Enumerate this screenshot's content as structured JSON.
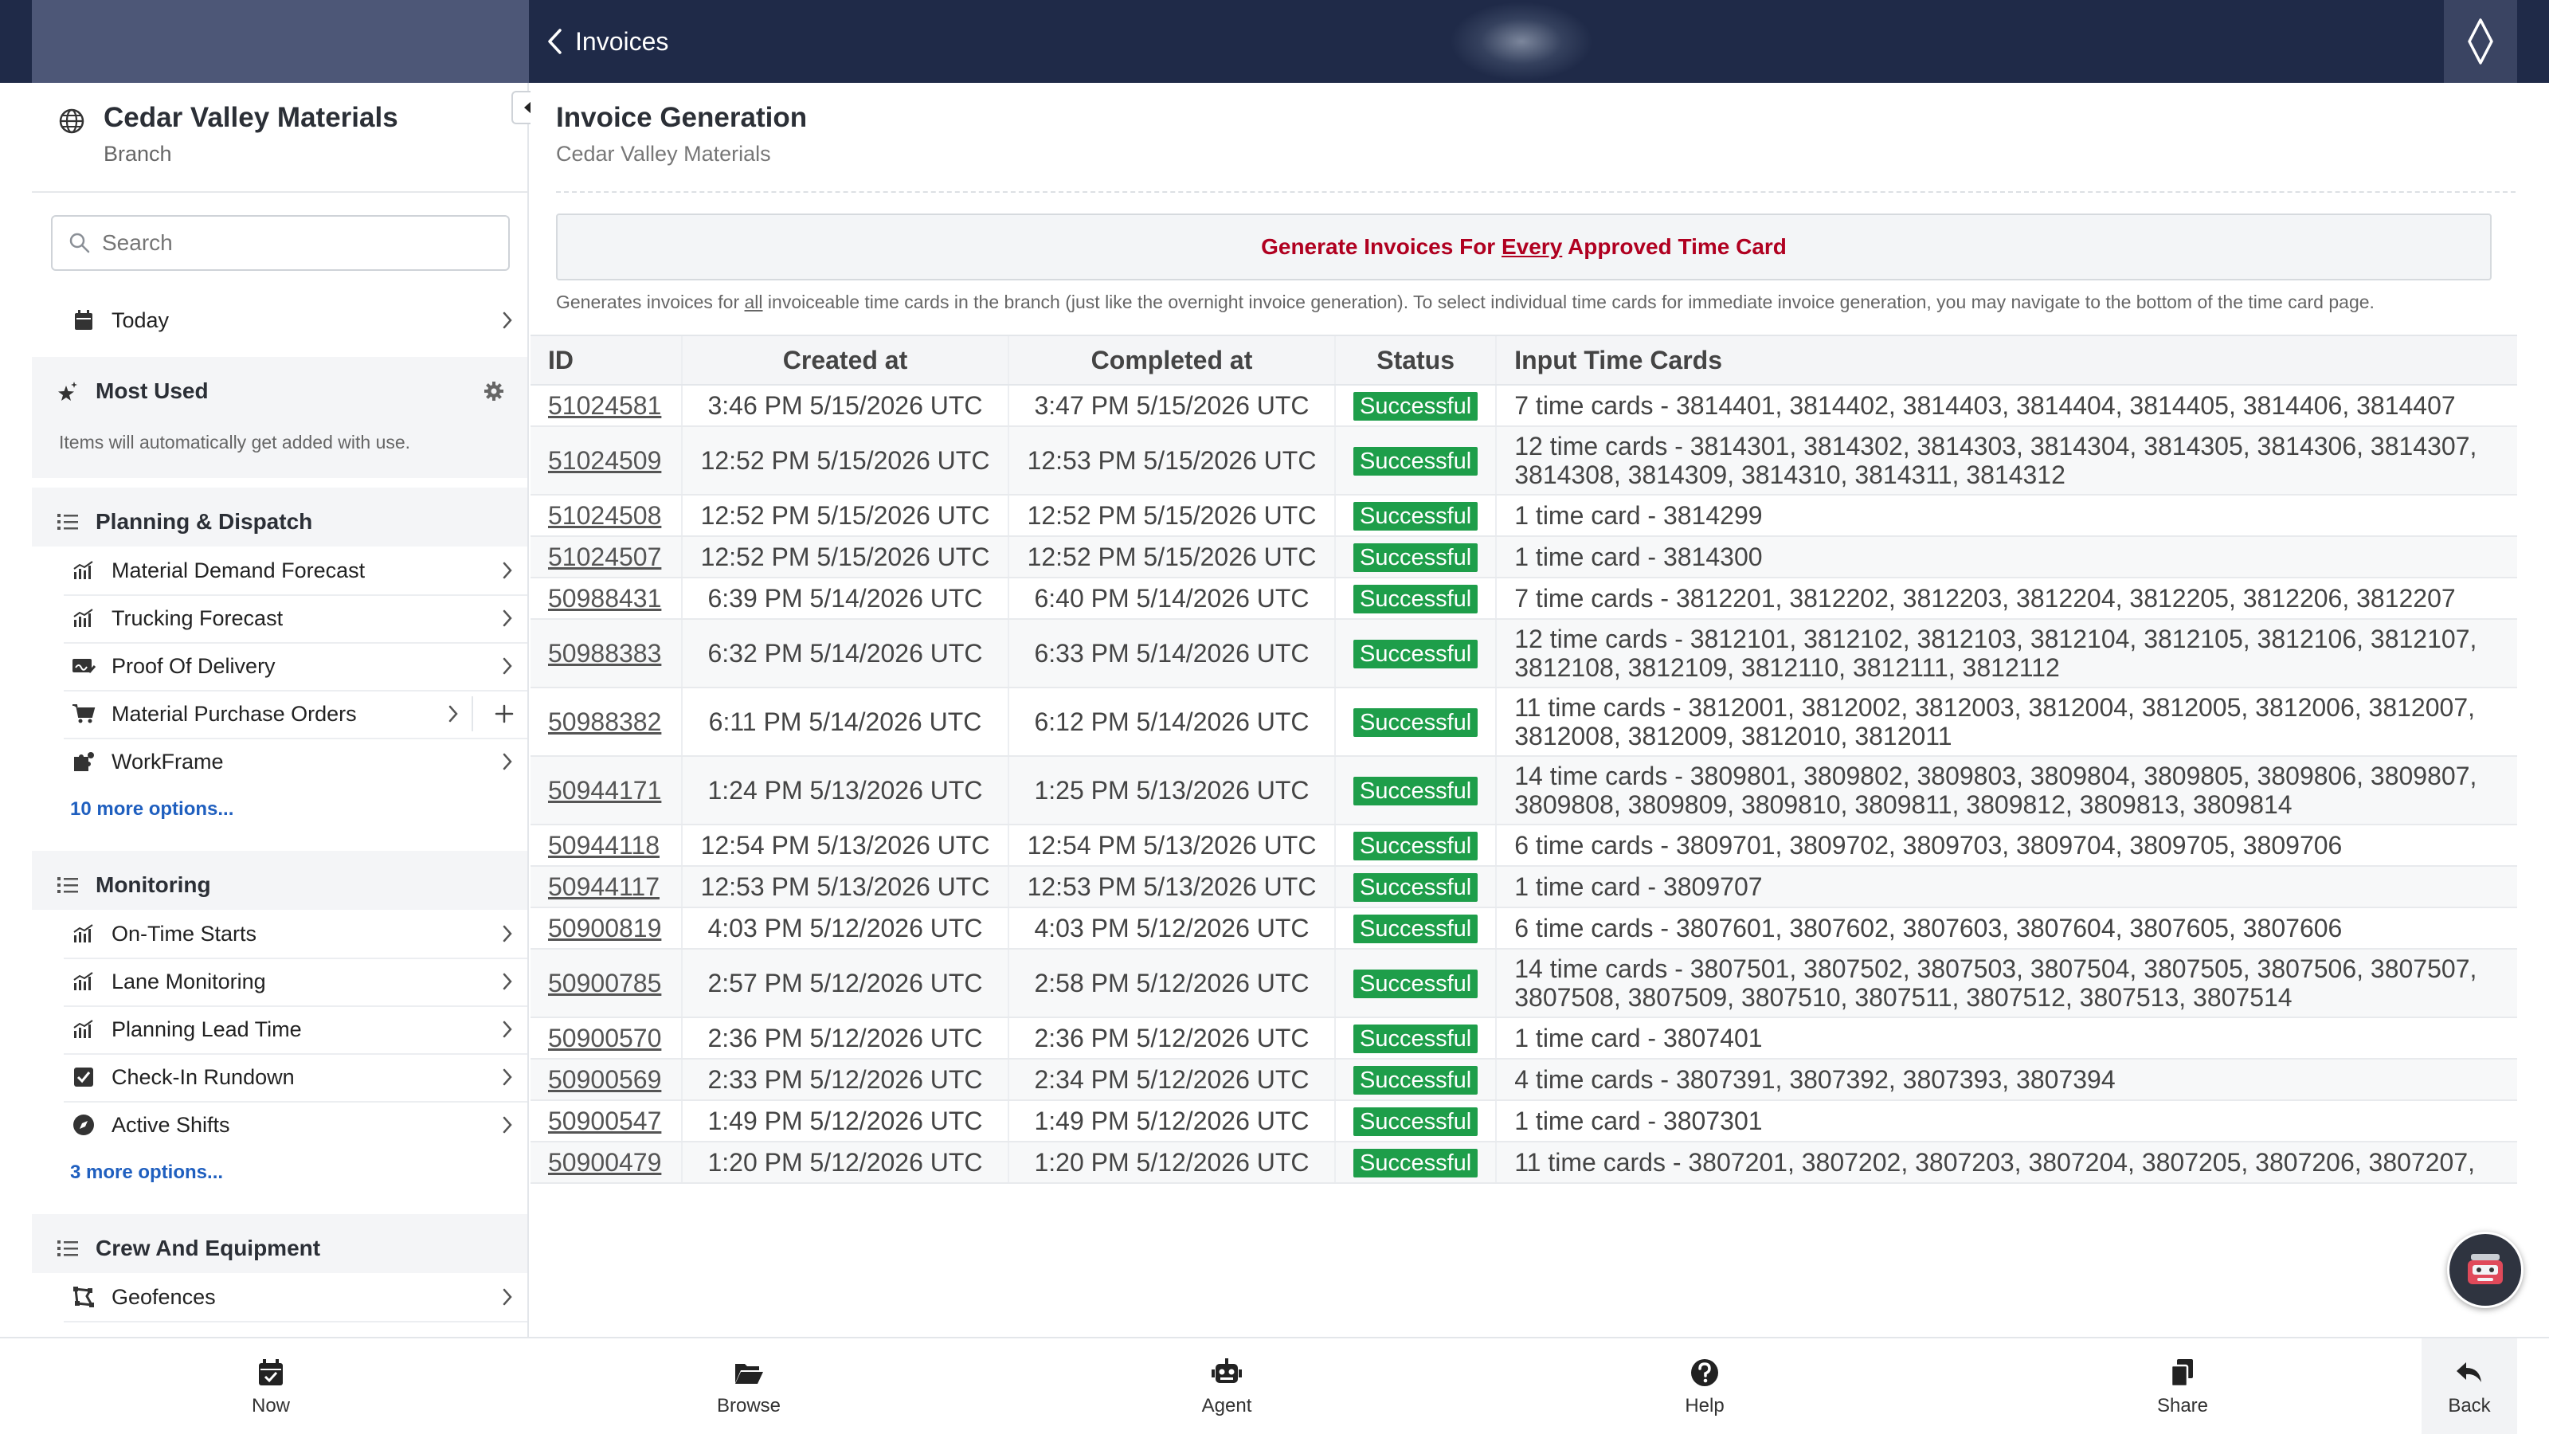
{
  "topbar": {
    "back_label": "Invoices"
  },
  "branch": {
    "name": "Cedar Valley Materials",
    "type": "Branch"
  },
  "search": {
    "placeholder": "Search"
  },
  "today": {
    "label": "Today"
  },
  "most_used": {
    "title": "Most Used",
    "note": "Items will automatically get added with use."
  },
  "planning": {
    "title": "Planning & Dispatch",
    "items": [
      {
        "label": "Material Demand Forecast",
        "icon": "chart-icon"
      },
      {
        "label": "Trucking Forecast",
        "icon": "chart-icon"
      },
      {
        "label": "Proof Of Delivery",
        "icon": "signature-icon"
      },
      {
        "label": "Material Purchase Orders",
        "icon": "cart-icon"
      },
      {
        "label": "WorkFrame",
        "icon": "puzzle-icon"
      }
    ],
    "more": "10 more options..."
  },
  "monitoring": {
    "title": "Monitoring",
    "items": [
      {
        "label": "On-Time Starts",
        "icon": "chart-icon"
      },
      {
        "label": "Lane Monitoring",
        "icon": "chart-icon"
      },
      {
        "label": "Planning Lead Time",
        "icon": "chart-icon"
      },
      {
        "label": "Check-In Rundown",
        "icon": "checkbox-icon"
      },
      {
        "label": "Active Shifts",
        "icon": "compass-icon"
      }
    ],
    "more": "3 more options..."
  },
  "crew": {
    "title": "Crew And Equipment",
    "items": [
      {
        "label": "Geofences",
        "icon": "geofence-icon"
      }
    ]
  },
  "main": {
    "title": "Invoice Generation",
    "subtitle": "Cedar Valley Materials",
    "generate_pre": "Generate Invoices For ",
    "generate_em": "Every",
    "generate_post": " Approved Time Card",
    "desc_pre": "Generates invoices for ",
    "desc_em": "all",
    "desc_post": " invoiceable time cards in the branch (just like the overnight invoice generation). To select individual time cards for immediate invoice generation, you may navigate to the bottom of the time card page."
  },
  "table": {
    "headers": [
      "ID",
      "Created at",
      "Completed at",
      "Status",
      "Input Time Cards"
    ],
    "rows": [
      {
        "id": "51024581",
        "created": "3:46 PM 5/15/2026 UTC",
        "completed": "3:47 PM 5/15/2026 UTC",
        "status": "Successful",
        "cards": "7 time cards - 3814401, 3814402, 3814403, 3814404, 3814405, 3814406, 3814407"
      },
      {
        "id": "51024509",
        "created": "12:52 PM 5/15/2026 UTC",
        "completed": "12:53 PM 5/15/2026 UTC",
        "status": "Successful",
        "cards": "12 time cards - 3814301, 3814302, 3814303, 3814304, 3814305, 3814306, 3814307, 3814308, 3814309, 3814310, 3814311, 3814312"
      },
      {
        "id": "51024508",
        "created": "12:52 PM 5/15/2026 UTC",
        "completed": "12:52 PM 5/15/2026 UTC",
        "status": "Successful",
        "cards": "1 time card - 3814299"
      },
      {
        "id": "51024507",
        "created": "12:52 PM 5/15/2026 UTC",
        "completed": "12:52 PM 5/15/2026 UTC",
        "status": "Successful",
        "cards": "1 time card - 3814300"
      },
      {
        "id": "50988431",
        "created": "6:39 PM 5/14/2026 UTC",
        "completed": "6:40 PM 5/14/2026 UTC",
        "status": "Successful",
        "cards": "7 time cards - 3812201, 3812202, 3812203, 3812204, 3812205, 3812206, 3812207"
      },
      {
        "id": "50988383",
        "created": "6:32 PM 5/14/2026 UTC",
        "completed": "6:33 PM 5/14/2026 UTC",
        "status": "Successful",
        "cards": "12 time cards - 3812101, 3812102, 3812103, 3812104, 3812105, 3812106, 3812107, 3812108, 3812109, 3812110, 3812111, 3812112"
      },
      {
        "id": "50988382",
        "created": "6:11 PM 5/14/2026 UTC",
        "completed": "6:12 PM 5/14/2026 UTC",
        "status": "Successful",
        "cards": "11 time cards - 3812001, 3812002, 3812003, 3812004, 3812005, 3812006, 3812007, 3812008, 3812009, 3812010, 3812011"
      },
      {
        "id": "50944171",
        "created": "1:24 PM 5/13/2026 UTC",
        "completed": "1:25 PM 5/13/2026 UTC",
        "status": "Successful",
        "cards": "14 time cards - 3809801, 3809802, 3809803, 3809804, 3809805, 3809806, 3809807, 3809808, 3809809, 3809810, 3809811, 3809812, 3809813, 3809814"
      },
      {
        "id": "50944118",
        "created": "12:54 PM 5/13/2026 UTC",
        "completed": "12:54 PM 5/13/2026 UTC",
        "status": "Successful",
        "cards": "6 time cards - 3809701, 3809702, 3809703, 3809704, 3809705, 3809706"
      },
      {
        "id": "50944117",
        "created": "12:53 PM 5/13/2026 UTC",
        "completed": "12:53 PM 5/13/2026 UTC",
        "status": "Successful",
        "cards": "1 time card - 3809707"
      },
      {
        "id": "50900819",
        "created": "4:03 PM 5/12/2026 UTC",
        "completed": "4:03 PM 5/12/2026 UTC",
        "status": "Successful",
        "cards": "6 time cards - 3807601, 3807602, 3807603, 3807604, 3807605, 3807606"
      },
      {
        "id": "50900785",
        "created": "2:57 PM 5/12/2026 UTC",
        "completed": "2:58 PM 5/12/2026 UTC",
        "status": "Successful",
        "cards": "14 time cards - 3807501, 3807502, 3807503, 3807504, 3807505, 3807506, 3807507, 3807508, 3807509, 3807510, 3807511, 3807512, 3807513, 3807514"
      },
      {
        "id": "50900570",
        "created": "2:36 PM 5/12/2026 UTC",
        "completed": "2:36 PM 5/12/2026 UTC",
        "status": "Successful",
        "cards": "1 time card - 3807401"
      },
      {
        "id": "50900569",
        "created": "2:33 PM 5/12/2026 UTC",
        "completed": "2:34 PM 5/12/2026 UTC",
        "status": "Successful",
        "cards": "4 time cards - 3807391, 3807392, 3807393, 3807394"
      },
      {
        "id": "50900547",
        "created": "1:49 PM 5/12/2026 UTC",
        "completed": "1:49 PM 5/12/2026 UTC",
        "status": "Successful",
        "cards": "1 time card - 3807301"
      },
      {
        "id": "50900479",
        "created": "1:20 PM 5/12/2026 UTC",
        "completed": "1:20 PM 5/12/2026 UTC",
        "status": "Successful",
        "cards": "11 time cards - 3807201, 3807202, 3807203, 3807204, 3807205, 3807206, 3807207,"
      }
    ]
  },
  "tabbar": {
    "now": "Now",
    "browse": "Browse",
    "agent": "Agent",
    "help": "Help",
    "share": "Share",
    "back": "Back"
  },
  "colors": {
    "topbar": "#1f2a48",
    "success": "#1e9e4a",
    "generate_text": "#b00020",
    "link": "#1f5fbf"
  }
}
